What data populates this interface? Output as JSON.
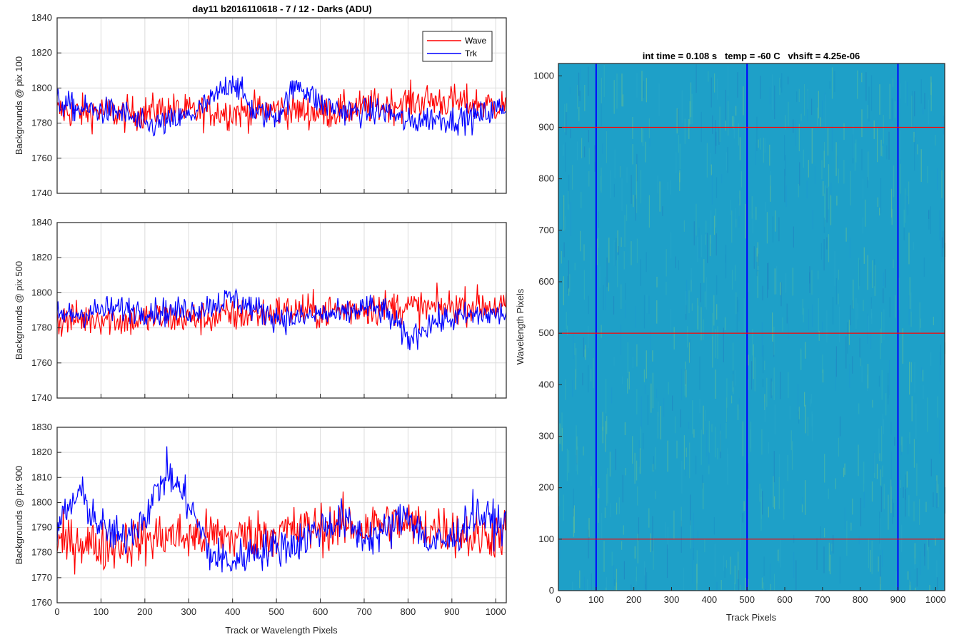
{
  "figure_title": "day11 b2016110618 - 7 / 12 - Darks (ADU)",
  "colors": {
    "wave": "#ff0000",
    "trk": "#0000ff",
    "image_base": "#1ea0c8"
  },
  "chart_data": [
    {
      "type": "line",
      "title": "day11 b2016110618 - 7 / 12 - Darks (ADU)",
      "xlabel": "",
      "ylabel": "Backgrounds @ pix 100",
      "xlim": [
        0,
        1024
      ],
      "ylim": [
        1740,
        1840
      ],
      "xticks": [
        0,
        100,
        200,
        300,
        400,
        500,
        600,
        700,
        800,
        900,
        1000
      ],
      "xtick_labels_shown": false,
      "yticks": [
        1740,
        1760,
        1780,
        1800,
        1820,
        1840
      ],
      "grid": true,
      "legend": {
        "position": "top-right",
        "entries": [
          "Wave",
          "Trk"
        ]
      },
      "series": [
        {
          "name": "Wave",
          "color": "#ff0000",
          "x": [
            0,
            50,
            100,
            150,
            200,
            250,
            300,
            350,
            400,
            450,
            500,
            550,
            600,
            650,
            700,
            750,
            800,
            850,
            900,
            950,
            1024
          ],
          "y": [
            1787,
            1786,
            1787,
            1785,
            1786,
            1788,
            1786,
            1787,
            1786,
            1787,
            1788,
            1787,
            1786,
            1787,
            1789,
            1790,
            1792,
            1793,
            1792,
            1791,
            1790
          ]
        },
        {
          "name": "Trk",
          "color": "#0000ff",
          "x": [
            0,
            50,
            100,
            150,
            200,
            250,
            300,
            350,
            400,
            450,
            500,
            550,
            600,
            650,
            700,
            750,
            800,
            850,
            900,
            950,
            1024
          ],
          "y": [
            1792,
            1788,
            1787,
            1786,
            1778,
            1780,
            1784,
            1792,
            1805,
            1786,
            1784,
            1803,
            1791,
            1787,
            1786,
            1787,
            1780,
            1783,
            1782,
            1783,
            1790
          ]
        }
      ]
    },
    {
      "type": "line",
      "xlabel": "",
      "ylabel": "Backgrounds @ pix 500",
      "xlim": [
        0,
        1024
      ],
      "ylim": [
        1740,
        1840
      ],
      "xticks": [
        0,
        100,
        200,
        300,
        400,
        500,
        600,
        700,
        800,
        900,
        1000
      ],
      "xtick_labels_shown": false,
      "yticks": [
        1740,
        1760,
        1780,
        1800,
        1820,
        1840
      ],
      "grid": true,
      "series": [
        {
          "name": "Wave",
          "color": "#ff0000",
          "x": [
            0,
            50,
            100,
            150,
            200,
            250,
            300,
            350,
            400,
            450,
            500,
            550,
            600,
            650,
            700,
            750,
            800,
            850,
            900,
            950,
            1024
          ],
          "y": [
            1784,
            1785,
            1786,
            1784,
            1785,
            1786,
            1785,
            1786,
            1787,
            1788,
            1789,
            1790,
            1789,
            1790,
            1791,
            1792,
            1792,
            1791,
            1792,
            1793,
            1792
          ]
        },
        {
          "name": "Trk",
          "color": "#0000ff",
          "x": [
            0,
            50,
            100,
            150,
            200,
            250,
            300,
            350,
            400,
            450,
            500,
            550,
            600,
            650,
            700,
            750,
            800,
            850,
            900,
            950,
            1024
          ],
          "y": [
            1787,
            1788,
            1790,
            1791,
            1790,
            1789,
            1790,
            1793,
            1797,
            1791,
            1786,
            1785,
            1788,
            1787,
            1792,
            1789,
            1773,
            1783,
            1785,
            1787,
            1788
          ]
        }
      ]
    },
    {
      "type": "line",
      "xlabel": "Track or Wavelength Pixels",
      "ylabel": "Backgrounds @ pix 900",
      "xlim": [
        0,
        1024
      ],
      "ylim": [
        1760,
        1830
      ],
      "xticks": [
        0,
        100,
        200,
        300,
        400,
        500,
        600,
        700,
        800,
        900,
        1000
      ],
      "xtick_labels_shown": true,
      "yticks": [
        1760,
        1770,
        1780,
        1790,
        1800,
        1810,
        1820,
        1830
      ],
      "grid": true,
      "series": [
        {
          "name": "Wave",
          "color": "#ff0000",
          "x": [
            0,
            50,
            100,
            150,
            200,
            250,
            300,
            350,
            400,
            450,
            500,
            550,
            600,
            650,
            700,
            750,
            800,
            850,
            900,
            950,
            1024
          ],
          "y": [
            1783,
            1785,
            1782,
            1784,
            1785,
            1787,
            1786,
            1787,
            1786,
            1787,
            1788,
            1789,
            1790,
            1791,
            1790,
            1792,
            1791,
            1790,
            1789,
            1786,
            1788
          ]
        },
        {
          "name": "Trk",
          "color": "#0000ff",
          "x": [
            0,
            50,
            100,
            150,
            200,
            250,
            300,
            350,
            400,
            450,
            500,
            550,
            600,
            650,
            700,
            750,
            800,
            850,
            900,
            950,
            1024
          ],
          "y": [
            1790,
            1804,
            1790,
            1785,
            1795,
            1812,
            1800,
            1779,
            1776,
            1781,
            1782,
            1784,
            1790,
            1793,
            1786,
            1788,
            1796,
            1783,
            1785,
            1796,
            1790
          ]
        }
      ]
    },
    {
      "type": "heatmap",
      "title": "int time = 0.108 s   temp = -60 C   vhsift = 4.25e-06",
      "xlabel": "Track Pixels",
      "ylabel": "Wavelength Pixels",
      "xlim": [
        0,
        1024
      ],
      "ylim": [
        0,
        1024
      ],
      "xticks": [
        0,
        100,
        200,
        300,
        400,
        500,
        600,
        700,
        800,
        900,
        1000
      ],
      "yticks": [
        0,
        100,
        200,
        300,
        400,
        500,
        600,
        700,
        800,
        900,
        1000
      ],
      "vertical_markers": {
        "color": "#0000ff",
        "x": [
          100,
          500,
          900
        ]
      },
      "horizontal_markers": {
        "color": "#ff0000",
        "y": [
          100,
          500,
          900
        ]
      }
    }
  ]
}
